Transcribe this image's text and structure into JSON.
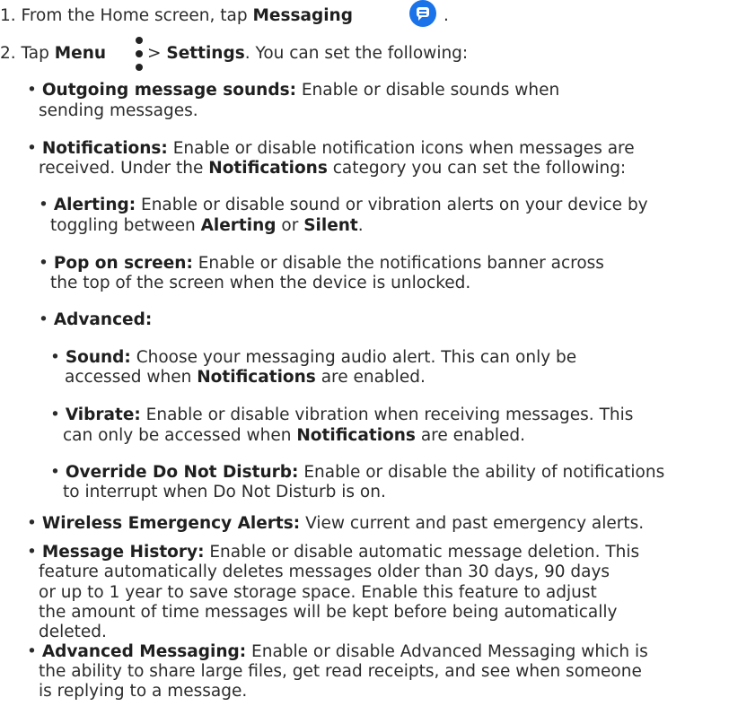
{
  "colors": {
    "text": "#2b2b2b",
    "icon_accent": "#1a73e8"
  },
  "icons": {
    "messaging": "messaging-app-icon",
    "menu": "vertical-ellipsis-menu-icon"
  },
  "step1": {
    "prefix": "1. From the Home screen, tap ",
    "bold": "Messaging",
    "suffix": "."
  },
  "step2": {
    "prefix": "2. Tap ",
    "menu": "Menu",
    "sep": " > ",
    "settings": "Settings",
    "suffix": ". You can set the following:"
  },
  "items": {
    "outgoing": {
      "label": "Outgoing message sounds:",
      "l1": " Enable or disable sounds when",
      "l2": "sending messages."
    },
    "notifications": {
      "label": "Notifications:",
      "l1": " Enable or disable notification icons when messages are",
      "l2a": "received. Under the ",
      "l2b": "Notifications",
      "l2c": " category you can set the following:"
    },
    "alerting": {
      "label": "Alerting:",
      "l1": " Enable or disable sound or vibration alerts on your device by",
      "l2a": "toggling between ",
      "l2b": "Alerting",
      "l2c": " or ",
      "l2d": "Silent",
      "l2e": "."
    },
    "pop": {
      "label": "Pop on screen:",
      "l1": " Enable or disable the notifications banner across",
      "l2": "the top of the screen when the device is unlocked."
    },
    "advanced": {
      "label": "Advanced:"
    },
    "sound": {
      "label": "Sound:",
      "l1": " Choose your messaging audio alert. This can only be",
      "l2a": "accessed when ",
      "l2b": "Notifications",
      "l2c": " are enabled."
    },
    "vibrate": {
      "label": "Vibrate:",
      "l1": " Enable or disable vibration when receiving messages. This",
      "l2a": "can only be accessed when ",
      "l2b": "Notifications",
      "l2c": " are enabled."
    },
    "override": {
      "label": "Override Do Not Disturb:",
      "l1": " Enable or disable the ability of notifications",
      "l2": "to interrupt when Do Not Disturb is on."
    },
    "wea": {
      "label": "Wireless Emergency Alerts:",
      "l1": " View current and past emergency alerts."
    },
    "history": {
      "label": "Message History:",
      "l1": " Enable or disable automatic message deletion. This",
      "l2": "feature automatically deletes messages older than 30 days, 90 days",
      "l3": "or up to 1 year to save storage space. Enable this feature to adjust",
      "l4": "the amount of time messages will be kept before being automatically",
      "l5": "deleted."
    },
    "advmsg": {
      "label": "Advanced Messaging:",
      "l1": " Enable or disable Advanced Messaging which is",
      "l2": "the ability to share large files, get read receipts, and see when someone",
      "l3": "is replying to a message."
    }
  },
  "bullet": "•"
}
